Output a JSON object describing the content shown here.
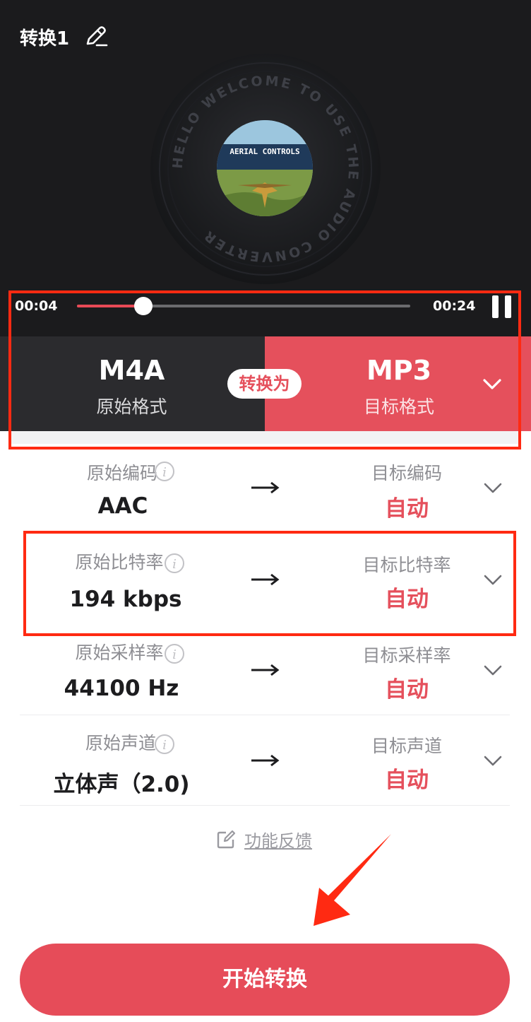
{
  "header": {
    "title": "转换1",
    "edit_icon": "pencil-icon"
  },
  "disc": {
    "ring_text": "HELLO WELCOME TO USE THE AUDIO CONVERTER",
    "cover_title": "AERIAL CONTROLS"
  },
  "player": {
    "current_time": "00:04",
    "total_time": "00:24",
    "progress": 0.2,
    "state_icon": "pause-icon"
  },
  "formats": {
    "source_name": "M4A",
    "source_label": "原始格式",
    "convert_label": "转换为",
    "target_name": "MP3",
    "target_label": "目标格式",
    "chevron_icon": "chevron-down-icon"
  },
  "settings": [
    {
      "orig_label": "原始编码",
      "orig_value": "AAC",
      "target_label": "目标编码",
      "target_value": "自动"
    },
    {
      "orig_label": "原始比特率",
      "orig_value": "194 kbps",
      "target_label": "目标比特率",
      "target_value": "自动"
    },
    {
      "orig_label": "原始采样率",
      "orig_value": "44100 Hz",
      "target_label": "目标采样率",
      "target_value": "自动"
    },
    {
      "orig_label": "原始声道",
      "orig_value": "立体声（2.0)",
      "target_label": "目标声道",
      "target_value": "自动"
    }
  ],
  "feedback": {
    "label": "功能反馈"
  },
  "start_button": {
    "label": "开始转换"
  },
  "colors": {
    "accent": "#e5505c",
    "dark_bg": "#1b1b1d",
    "panel_dark": "#2b2b2e",
    "annotation": "#ff2a12"
  }
}
